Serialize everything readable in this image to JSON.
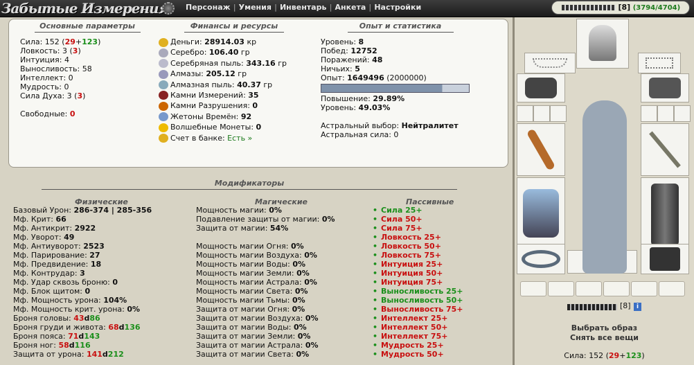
{
  "header": {
    "logo_text": "Забытые Измерения",
    "nav": [
      "Персонаж",
      "Умения",
      "Инвентарь",
      "Анкета",
      "Настройки"
    ],
    "char_level": "[8]",
    "char_hp": "(3794/4704)"
  },
  "basic": {
    "title": "Основные параметры",
    "lines": [
      [
        [
          "Сила: 152 (",
          ""
        ],
        [
          "29",
          "red"
        ],
        [
          "+",
          ""
        ],
        [
          "123",
          "green"
        ],
        [
          ")",
          ""
        ]
      ],
      [
        [
          "Ловкость: 3 (",
          ""
        ],
        [
          "3",
          "red"
        ],
        [
          ")",
          ""
        ]
      ],
      [
        [
          "Интуиция: 4",
          ""
        ]
      ],
      [
        [
          "Выносливость: 58",
          ""
        ]
      ],
      [
        [
          "Интеллект: 0",
          ""
        ]
      ],
      [
        [
          "Мудрость: 0",
          ""
        ]
      ],
      [
        [
          "Сила Духа: 3 (",
          ""
        ],
        [
          "3",
          "red"
        ],
        [
          ")",
          ""
        ]
      ]
    ],
    "free_label": "Свободные:",
    "free_value": "0"
  },
  "finance": {
    "title": "Финансы и ресурсы",
    "items": [
      {
        "label": "Деньги:",
        "value": "28914.03",
        "unit": "кр",
        "icon": "money-icon",
        "color": "#e0b020"
      },
      {
        "label": "Серебро:",
        "value": "106.40",
        "unit": "гр",
        "icon": "silver-icon",
        "color": "#aab"
      },
      {
        "label": "Серебряная пыль:",
        "value": "343.16",
        "unit": "гр",
        "icon": "silver-dust-icon",
        "color": "#bbc"
      },
      {
        "label": "Алмазы:",
        "value": "205.12",
        "unit": "гр",
        "icon": "diamond-icon",
        "color": "#99b"
      },
      {
        "label": "Алмазная пыль:",
        "value": "40.37",
        "unit": "гр",
        "icon": "diamond-dust-icon",
        "color": "#8ab"
      },
      {
        "label": "Камни Измерений:",
        "value": "35",
        "unit": "",
        "icon": "dimension-stone-icon",
        "color": "#822"
      },
      {
        "label": "Камни Разрушения:",
        "value": "0",
        "unit": "",
        "icon": "destruction-stone-icon",
        "color": "#c60"
      },
      {
        "label": "Жетоны Времён:",
        "value": "92",
        "unit": "",
        "icon": "time-token-icon",
        "color": "#79c"
      },
      {
        "label": "Волшебные Монеты:",
        "value": "0",
        "unit": "",
        "icon": "magic-coin-icon",
        "color": "#eb0"
      }
    ],
    "bank_label": "Счет в банке:",
    "bank_link": "Есть »"
  },
  "stats": {
    "title": "Опыт и статистика",
    "lines": [
      [
        "Уровень:",
        "8"
      ],
      [
        "Побед:",
        "12752"
      ],
      [
        "Поражений:",
        "48"
      ],
      [
        "Ничьих:",
        "5"
      ]
    ],
    "exp_label": "Опыт:",
    "exp_value": "1649496",
    "exp_next": "(2000000)",
    "exp_fraction": 0.82,
    "lines2": [
      [
        "Повышение:",
        "29.89%"
      ],
      [
        "Уровень:",
        "49.03%"
      ]
    ],
    "astral_label": "Астральный выбор:",
    "astral_value": "Нейтралитет",
    "astral_power": "Астральная сила: 0"
  },
  "modifiers": {
    "title": "Модификаторы",
    "physical_title": "Физические",
    "magic_title": "Магические",
    "passive_title": "Пассивные",
    "physical": [
      [
        [
          "Базовый Урон: ",
          ""
        ],
        [
          "286-374 | 285-356",
          "b"
        ]
      ],
      [
        [
          "Мф. Крит: ",
          ""
        ],
        [
          "66",
          "b"
        ]
      ],
      [
        [
          "Мф. Антикрит: ",
          ""
        ],
        [
          "2922",
          "b"
        ]
      ],
      [
        [
          "Мф. Уворот: ",
          ""
        ],
        [
          "49",
          "b"
        ]
      ],
      [
        [
          "Мф. Антиуворот: ",
          ""
        ],
        [
          "2523",
          "b"
        ]
      ],
      [
        [
          "Мф. Парирование: ",
          ""
        ],
        [
          "27",
          "b"
        ]
      ],
      [
        [
          "Мф. Предвидение: ",
          ""
        ],
        [
          "18",
          "b"
        ]
      ],
      [
        [
          "Мф. Контрудар: ",
          ""
        ],
        [
          "3",
          "b"
        ]
      ],
      [
        [
          "Мф. Удар сквозь броню: ",
          ""
        ],
        [
          "0",
          "b"
        ]
      ],
      [
        [
          "Мф. Блок щитом: ",
          ""
        ],
        [
          "0",
          "b"
        ]
      ],
      [
        [
          "Мф. Мощность урона: ",
          ""
        ],
        [
          "104%",
          "b"
        ]
      ],
      [
        [
          "Мф. Мощность крит. урона: ",
          ""
        ],
        [
          "0%",
          "b"
        ]
      ],
      [
        [
          "Броня головы: ",
          ""
        ],
        [
          "43",
          "red"
        ],
        [
          "d",
          "b"
        ],
        [
          "86",
          "green"
        ]
      ],
      [
        [
          "Броня груди и живота: ",
          ""
        ],
        [
          "68",
          "red"
        ],
        [
          "d",
          "b"
        ],
        [
          "136",
          "green"
        ]
      ],
      [
        [
          "Броня пояса: ",
          ""
        ],
        [
          "71",
          "red"
        ],
        [
          "d",
          "b"
        ],
        [
          "143",
          "green"
        ]
      ],
      [
        [
          "Броня ног: ",
          ""
        ],
        [
          "58",
          "red"
        ],
        [
          "d",
          "b"
        ],
        [
          "116",
          "green"
        ]
      ],
      [
        [
          "Защита от урона: ",
          ""
        ],
        [
          "141",
          "red"
        ],
        [
          "d",
          "b"
        ],
        [
          "212",
          "green"
        ]
      ]
    ],
    "magic": [
      [
        "Мощность магии: ",
        "0%"
      ],
      [
        "Подавление защиты от магии: ",
        "0%"
      ],
      [
        "Защита от магии: ",
        "54%"
      ],
      [
        "",
        ""
      ],
      [
        "Мощность магии Огня: ",
        "0%"
      ],
      [
        "Мощность магии Воздуха: ",
        "0%"
      ],
      [
        "Мощность магии Воды: ",
        "0%"
      ],
      [
        "Мощность магии Земли: ",
        "0%"
      ],
      [
        "Мощность магии Астрала: ",
        "0%"
      ],
      [
        "Мощность магии Света: ",
        "0%"
      ],
      [
        "Мощность магии Тьмы: ",
        "0%"
      ],
      [
        "Защита от магии Огня: ",
        "0%"
      ],
      [
        "Защита от магии Воздуха: ",
        "0%"
      ],
      [
        "Защита от магии Воды: ",
        "0%"
      ],
      [
        "Защита от магии Земли: ",
        "0%"
      ],
      [
        "Защита от магии Астрала: ",
        "0%"
      ],
      [
        "Защита от магии Света: ",
        "0%"
      ]
    ],
    "passive": [
      [
        "Сила 25+",
        "green"
      ],
      [
        "Сила 50+",
        "red"
      ],
      [
        "Сила 75+",
        "red"
      ],
      [
        "Ловкость 25+",
        "red"
      ],
      [
        "Ловкость 50+",
        "red"
      ],
      [
        "Ловкость 75+",
        "red"
      ],
      [
        "Интуиция 25+",
        "red"
      ],
      [
        "Интуиция 50+",
        "red"
      ],
      [
        "Интуиция 75+",
        "red"
      ],
      [
        "Выносливость 25+",
        "green"
      ],
      [
        "Выносливость 50+",
        "green"
      ],
      [
        "Выносливость 75+",
        "red"
      ],
      [
        "Интеллект 25+",
        "red"
      ],
      [
        "Интеллект 50+",
        "red"
      ],
      [
        "Интеллект 75+",
        "red"
      ],
      [
        "Мудрость 25+",
        "red"
      ],
      [
        "Мудрость 50+",
        "red"
      ]
    ]
  },
  "equipment": {
    "level": "[8]",
    "info": "i",
    "choose_image": "Выбрать образ",
    "remove_all": "Снять все вещи",
    "sila_label": "Сила:",
    "sila_base": "152",
    "sila_red": "29",
    "sila_green": "123"
  }
}
